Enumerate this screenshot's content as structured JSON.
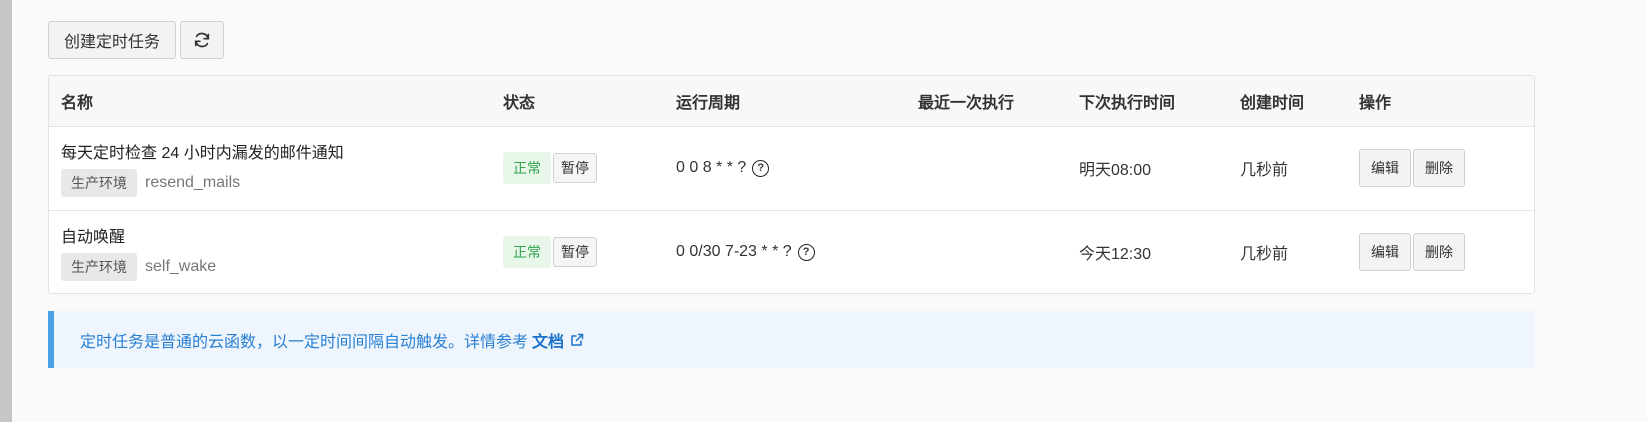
{
  "toolbar": {
    "create_label": "创建定时任务",
    "refresh_icon": "refresh-icon"
  },
  "table": {
    "headers": [
      "名称",
      "状态",
      "运行周期",
      "最近一次执行",
      "下次执行时间",
      "创建时间",
      "操作"
    ],
    "rows": [
      {
        "name": "每天定时检查 24 小时内漏发的邮件通知",
        "env": "生产环境",
        "func": "resend_mails",
        "status": "正常",
        "pause_label": "暂停",
        "cron": "0 0 8 * * ?",
        "last_run": "",
        "next_run": "明天08:00",
        "created": "几秒前",
        "edit_label": "编辑",
        "delete_label": "删除"
      },
      {
        "name": "自动唤醒",
        "env": "生产环境",
        "func": "self_wake",
        "status": "正常",
        "pause_label": "暂停",
        "cron": "0 0/30 7-23 * * ?",
        "last_run": "",
        "next_run": "今天12:30",
        "created": "几秒前",
        "edit_label": "编辑",
        "delete_label": "删除"
      }
    ]
  },
  "notice": {
    "text": "定时任务是普通的云函数，以一定时间间隔自动触发。详情参考",
    "link": "文档"
  },
  "colors": {
    "status_ok": "#2ea44f",
    "notice_border": "#4aa2e5",
    "link": "#1a73c8"
  }
}
